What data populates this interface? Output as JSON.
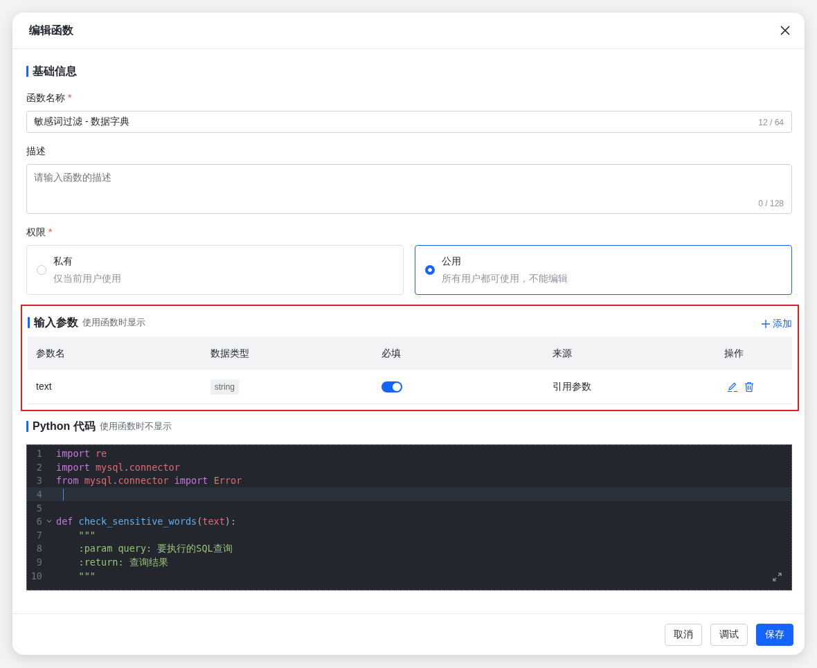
{
  "dialog": {
    "title": "编辑函数"
  },
  "basic": {
    "title": "基础信息",
    "name_field": {
      "label": "函数名称",
      "required_mark": "*",
      "value": "敏感词过滤 - 数据字典",
      "counter": "12 / 64"
    },
    "description_field": {
      "label": "描述",
      "placeholder": "请输入函数的描述",
      "counter": "0 / 128"
    },
    "permission": {
      "label": "权限",
      "required_mark": "*",
      "options": [
        {
          "title": "私有",
          "description": "仅当前用户使用",
          "selected": false
        },
        {
          "title": "公用",
          "description": "所有用户都可使用，不能编辑",
          "selected": true
        }
      ]
    }
  },
  "input_params": {
    "title": "输入参数",
    "hint": "使用函数时显示",
    "add_label": "添加",
    "columns": [
      "参数名",
      "数据类型",
      "必填",
      "来源",
      "操作"
    ],
    "rows": [
      {
        "name": "text",
        "type": "string",
        "required": true,
        "source": "引用参数"
      }
    ]
  },
  "code": {
    "title": "Python 代码",
    "hint": "使用函数时不显示",
    "lines": [
      {
        "number": "1",
        "active": false,
        "foldable": false,
        "indented": false,
        "tokens": [
          {
            "kind": "keyword",
            "text": "import"
          },
          {
            "kind": "module",
            "text": " re"
          }
        ]
      },
      {
        "number": "2",
        "active": false,
        "foldable": false,
        "indented": false,
        "tokens": [
          {
            "kind": "keyword",
            "text": "import"
          },
          {
            "kind": "module",
            "text": " mysql"
          },
          {
            "kind": "punct",
            "text": "."
          },
          {
            "kind": "module",
            "text": "connector"
          }
        ]
      },
      {
        "number": "3",
        "active": false,
        "foldable": false,
        "indented": false,
        "tokens": [
          {
            "kind": "keyword",
            "text": "from"
          },
          {
            "kind": "module",
            "text": " mysql"
          },
          {
            "kind": "punct",
            "text": "."
          },
          {
            "kind": "module",
            "text": "connector"
          },
          {
            "kind": "keyword",
            "text": " import"
          },
          {
            "kind": "module",
            "text": " Error"
          }
        ]
      },
      {
        "number": "4",
        "active": true,
        "foldable": false,
        "indented": false
      },
      {
        "number": "5",
        "active": false,
        "foldable": false,
        "indented": false
      },
      {
        "number": "6",
        "active": false,
        "foldable": true,
        "indented": false,
        "tokens": [
          {
            "kind": "keyword",
            "text": "def"
          },
          {
            "kind": "function",
            "text": " check_sensitive_words"
          },
          {
            "kind": "plain",
            "text": "("
          },
          {
            "kind": "module",
            "text": "text"
          },
          {
            "kind": "plain",
            "text": "):"
          }
        ]
      },
      {
        "number": "7",
        "active": false,
        "foldable": false,
        "indented": true,
        "tokens": [
          {
            "kind": "string",
            "text": "\"\"\""
          }
        ]
      },
      {
        "number": "8",
        "active": false,
        "foldable": false,
        "indented": true,
        "tokens": [
          {
            "kind": "string",
            "text": ":param query: 要执行的SQL查询"
          }
        ]
      },
      {
        "number": "9",
        "active": false,
        "foldable": false,
        "indented": true,
        "tokens": [
          {
            "kind": "string",
            "text": ":return: 查询结果"
          }
        ]
      },
      {
        "number": "10",
        "active": false,
        "foldable": false,
        "indented": true,
        "tokens": [
          {
            "kind": "string",
            "text": "\"\"\""
          }
        ]
      }
    ]
  },
  "footer": {
    "buttons": [
      {
        "label": "取消",
        "kind": "default"
      },
      {
        "label": "调试",
        "kind": "default"
      },
      {
        "label": "保存",
        "kind": "primary"
      }
    ]
  }
}
